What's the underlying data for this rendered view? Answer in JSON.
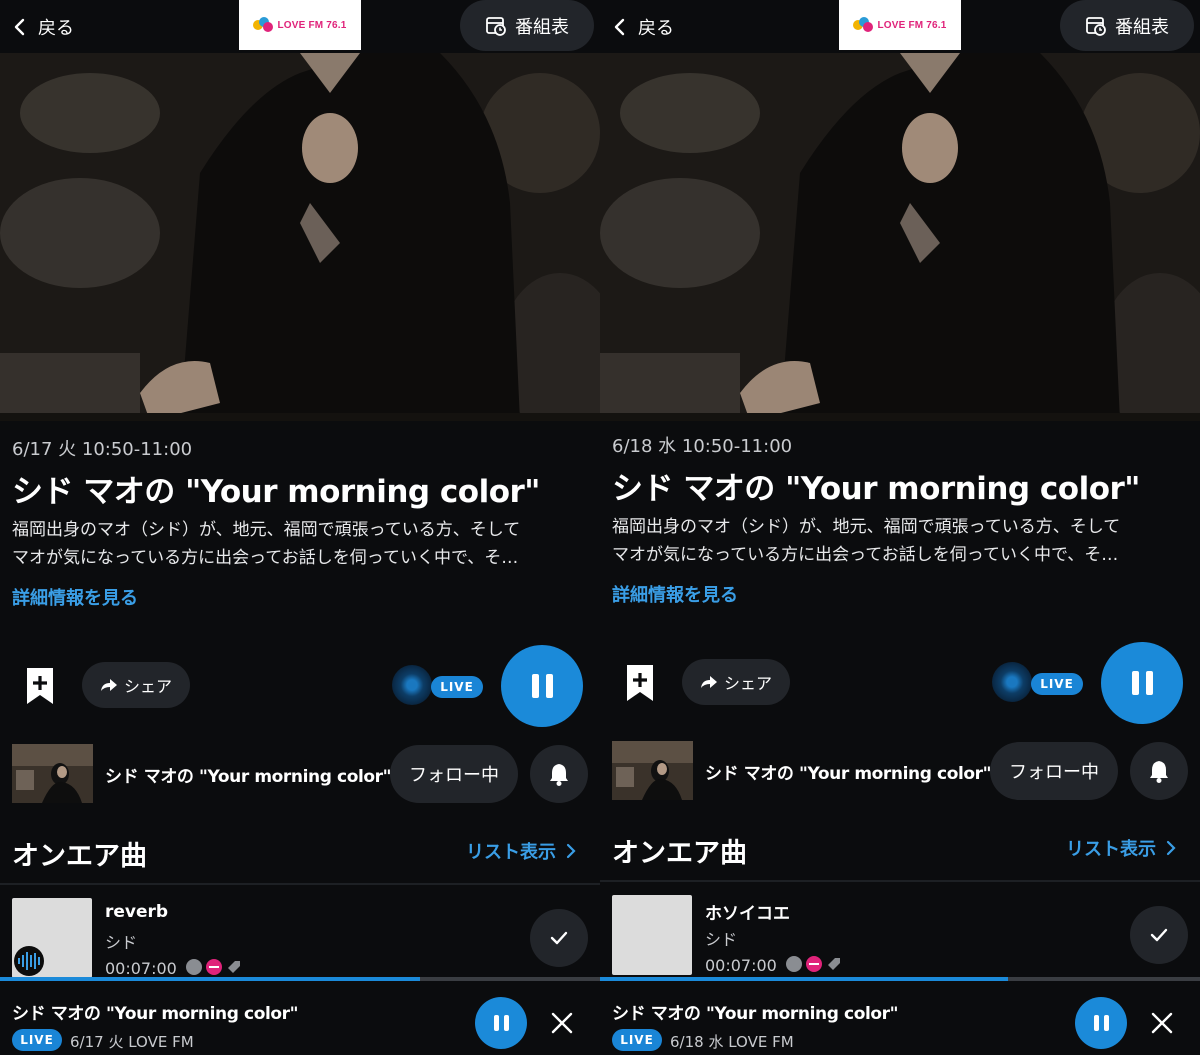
{
  "colors": {
    "background": "#0b0c0e",
    "accent": "#1b8ad9",
    "link": "#3a9ee6",
    "chip": "#22252a",
    "brand_pink": "#e0237a"
  },
  "panels": [
    {
      "header": {
        "back_label": "戻る",
        "back_icon": "chevron-left-icon",
        "logo_text": "LOVE FM 76.1",
        "schedule_label": "番組表",
        "schedule_icon": "calendar-clock-icon"
      },
      "program": {
        "datetime": "6/17 火 10:50-11:00",
        "title": "シド マオの \"Your morning color\"",
        "description_line1": "福岡出身のマオ（シド）が、地元、福岡で頑張っている方、そして",
        "description_line2": "マオが気になっている方に出会ってお話しを伺っていく中で、そ…",
        "details_link": "詳細情報を見る"
      },
      "actions": {
        "bookmark_icon": "bookmark-add-icon",
        "share_label": "シェア",
        "share_icon": "share-arrow-icon",
        "live_label": "LIVE",
        "pause_icon": "pause-icon"
      },
      "program_row": {
        "name": "シド マオの \"Your morning color\"",
        "follow_label": "フォロー中",
        "bell_icon": "bell-icon"
      },
      "onair": {
        "heading": "オンエア曲",
        "list_link": "リスト表示",
        "song": {
          "title": "reverb",
          "artist": "シド",
          "duration": "00:07:00",
          "has_wave_badge": true
        }
      },
      "progress": 0.7,
      "mini_player": {
        "title": "シド マオの \"Your morning color\"",
        "live_label": "LIVE",
        "meta": "6/17 火 LOVE FM"
      }
    },
    {
      "header": {
        "back_label": "戻る",
        "back_icon": "chevron-left-icon",
        "logo_text": "LOVE FM 76.1",
        "schedule_label": "番組表",
        "schedule_icon": "calendar-clock-icon"
      },
      "program": {
        "datetime": "6/18 水 10:50-11:00",
        "title": "シド マオの \"Your morning color\"",
        "description_line1": "福岡出身のマオ（シド）が、地元、福岡で頑張っている方、そして",
        "description_line2": "マオが気になっている方に出会ってお話しを伺っていく中で、そ…",
        "details_link": "詳細情報を見る"
      },
      "actions": {
        "bookmark_icon": "bookmark-add-icon",
        "share_label": "シェア",
        "share_icon": "share-arrow-icon",
        "live_label": "LIVE",
        "pause_icon": "pause-icon"
      },
      "program_row": {
        "name": "シド マオの \"Your morning color\"",
        "follow_label": "フォロー中",
        "bell_icon": "bell-icon"
      },
      "onair": {
        "heading": "オンエア曲",
        "list_link": "リスト表示",
        "song": {
          "title": "ホソイコエ",
          "artist": "シド",
          "duration": "00:07:00",
          "has_wave_badge": false
        }
      },
      "progress": 0.68,
      "mini_player": {
        "title": "シド マオの \"Your morning color\"",
        "live_label": "LIVE",
        "meta": "6/18 水 LOVE FM"
      }
    }
  ]
}
